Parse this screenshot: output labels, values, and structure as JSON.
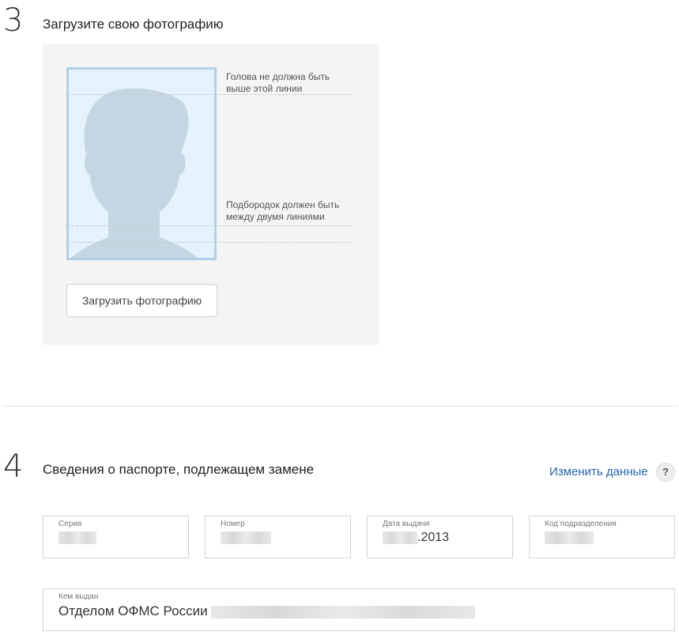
{
  "step3": {
    "number": "3",
    "title": "Загрузите свою фотографию",
    "hint_top": "Голова не должна быть выше этой линии",
    "hint_top_line1": "Голова не должна быть",
    "hint_top_line2": "выше этой линии",
    "hint_chin_line1": "Подбородок должен быть",
    "hint_chin_line2": "между двумя линиями",
    "upload_button": "Загрузить фотографию"
  },
  "step4": {
    "number": "4",
    "title": "Сведения о паспорте, подлежащем замене",
    "edit_link": "Изменить данные",
    "help_label": "?",
    "fields": {
      "series": {
        "label": "Серия",
        "value": ""
      },
      "number": {
        "label": "Номер",
        "value": ""
      },
      "issue_date": {
        "label": "Дата выдачи",
        "value": ".2013"
      },
      "division_code": {
        "label": "Код подразделения",
        "value": ""
      },
      "issued_by": {
        "label": "Кем выдан",
        "value": "Отделом ОФМС России"
      }
    }
  },
  "colors": {
    "panel_bg": "#f3f4f4",
    "frame_border": "#b2cfe8",
    "frame_bg": "#e4f3fb",
    "silhouette": "#c5d6e3",
    "link": "#2466a8"
  },
  "icons": [
    "person-silhouette-icon",
    "help-icon"
  ]
}
